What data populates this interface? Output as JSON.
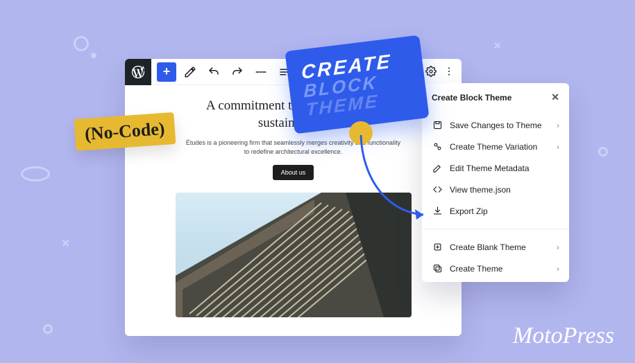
{
  "badge_nocode": "(No-Code)",
  "blue_card": {
    "line1": "CREATE",
    "line2": "BLOCK",
    "line3": "THEME"
  },
  "editor": {
    "headline_line1": "A commitment to innovation and",
    "headline_line2": "sustainability",
    "subtext_line1": "Études is a pioneering firm that seamlessly merges creativity and functionality",
    "subtext_line2": "to redefine architectural excellence.",
    "about_label": "About us"
  },
  "panel": {
    "title": "Create Block Theme",
    "items_top": [
      {
        "icon": "save-icon",
        "label": "Save Changes to Theme",
        "chevron": true
      },
      {
        "icon": "variation-icon",
        "label": "Create Theme Variation",
        "chevron": true
      },
      {
        "icon": "edit-icon",
        "label": "Edit Theme Metadata",
        "chevron": false
      },
      {
        "icon": "code-icon",
        "label": "View theme.json",
        "chevron": false
      },
      {
        "icon": "export-icon",
        "label": "Export Zip",
        "chevron": false
      }
    ],
    "items_bottom": [
      {
        "icon": "blank-icon",
        "label": "Create Blank Theme",
        "chevron": true
      },
      {
        "icon": "theme-icon",
        "label": "Create Theme",
        "chevron": true
      }
    ]
  },
  "brand": "MotoPress"
}
